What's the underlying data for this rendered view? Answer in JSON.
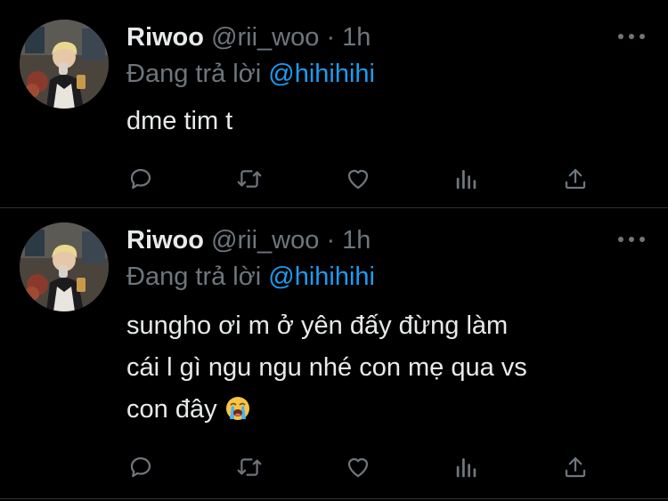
{
  "tweets": [
    {
      "display_name": "Riwoo",
      "handle": "@rii_woo",
      "separator": "·",
      "time": "1h",
      "reply_prefix": "Đang trả lời",
      "reply_to": "@hihihihi",
      "text_lines": [
        "dme tim t"
      ]
    },
    {
      "display_name": "Riwoo",
      "handle": "@rii_woo",
      "separator": "·",
      "time": "1h",
      "reply_prefix": "Đang trả lời",
      "reply_to": "@hihihihi",
      "text_lines": [
        "sungho ơi m ở yên đấy đừng làm",
        "cái l gì ngu ngu nhé con mẹ qua vs",
        "con đây"
      ],
      "emoji": "loudly-crying-face-emoji"
    }
  ],
  "icons": {
    "reply": "reply-icon",
    "retweet": "retweet-icon",
    "like": "heart-icon",
    "analytics": "analytics-icon",
    "share": "share-icon",
    "more": "more-icon"
  },
  "colors": {
    "background": "#000000",
    "text": "#e7e9ea",
    "muted": "#6e767d",
    "link": "#1d9bf0",
    "divider": "#2f3336"
  }
}
